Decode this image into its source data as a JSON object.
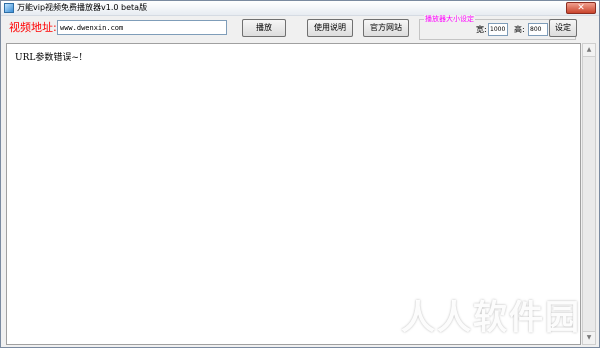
{
  "window": {
    "title": "万能vip视频免费播放器v1.0  beta版",
    "close_glyph": "✕"
  },
  "toolbar": {
    "url_label": "视频地址:",
    "url_value": "www.dwenxin.com",
    "play_label": "播放",
    "help_label": "使用说明",
    "website_label": "官方网站"
  },
  "player_size": {
    "group_title": "播放器大小设定",
    "width_label": "宽:",
    "width_value": "1000",
    "height_label": "高:",
    "height_value": "800",
    "set_label": "设定"
  },
  "content": {
    "message": "URL参数错误~!"
  },
  "watermark": {
    "text": "人人软件园"
  },
  "colors": {
    "url_label": "#ff0000",
    "group_title": "#ff00ff"
  },
  "icons": {
    "app": "app-icon",
    "close": "close-icon",
    "scroll_up": "chevron-up-icon",
    "scroll_down": "chevron-down-icon"
  }
}
